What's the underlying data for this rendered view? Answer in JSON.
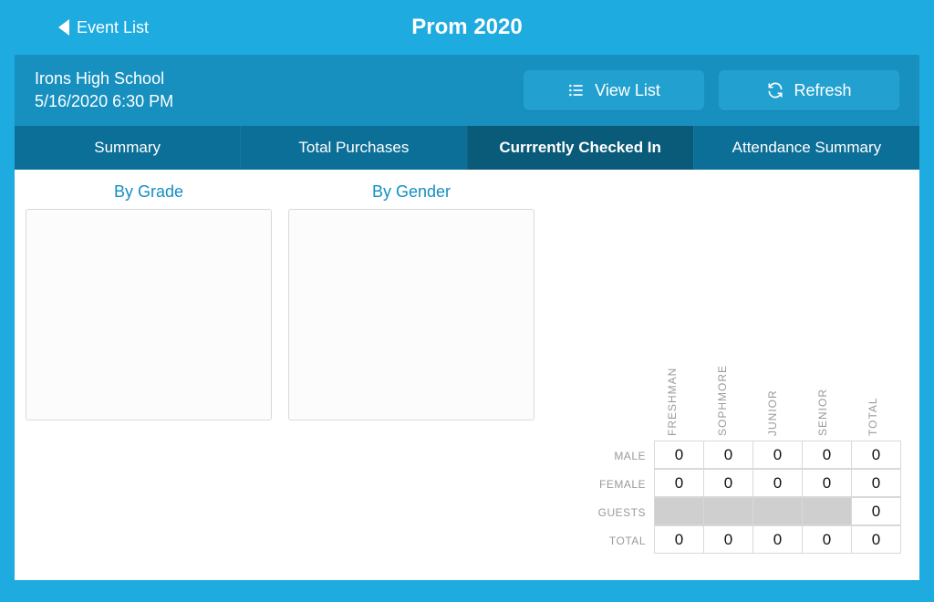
{
  "nav": {
    "back_label": "Event List",
    "title": "Prom 2020"
  },
  "subheader": {
    "school": "Irons High School",
    "datetime": "5/16/2020 6:30 PM",
    "view_list_label": "View List",
    "refresh_label": "Refresh"
  },
  "tabs": [
    {
      "label": "Summary"
    },
    {
      "label": "Total Purchases"
    },
    {
      "label": "Currrently Checked In"
    },
    {
      "label": "Attendance Summary"
    }
  ],
  "active_tab": 2,
  "charts": {
    "grade_title": "By Grade",
    "gender_title": "By Gender"
  },
  "table": {
    "columns": [
      "FRESHMAN",
      "SOPHMORE",
      "JUNIOR",
      "SENIOR",
      "TOTAL"
    ],
    "rows": [
      {
        "label": "MALE",
        "values": [
          "0",
          "0",
          "0",
          "0",
          "0"
        ]
      },
      {
        "label": "FEMALE",
        "values": [
          "0",
          "0",
          "0",
          "0",
          "0"
        ]
      },
      {
        "label": "GUESTS",
        "values": [
          null,
          null,
          null,
          null,
          "0"
        ]
      },
      {
        "label": "TOTAL",
        "values": [
          "0",
          "0",
          "0",
          "0",
          "0"
        ]
      }
    ]
  }
}
